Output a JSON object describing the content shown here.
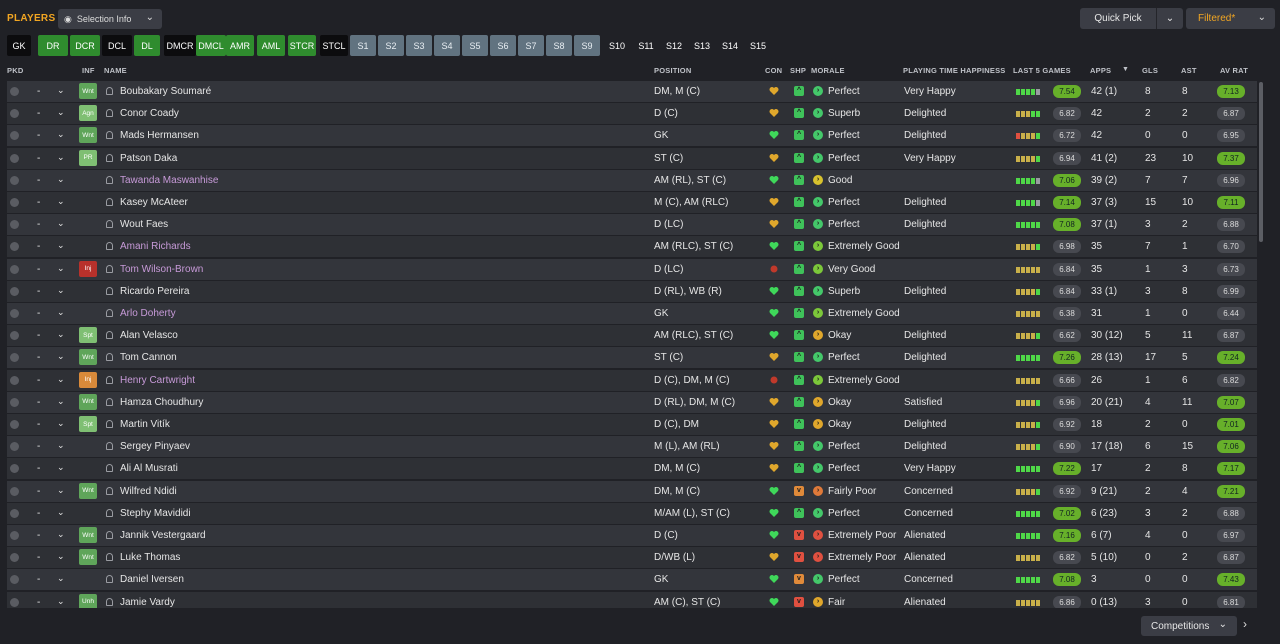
{
  "header": {
    "title": "PLAYERS",
    "selection_info": "Selection Info",
    "quick_pick": "Quick Pick",
    "filtered": "Filtered*",
    "competitions": "Competitions"
  },
  "icons": {
    "chevron": "chevron-down-icon",
    "eye": "eye-icon",
    "next": "chevron-right-icon"
  },
  "positions": [
    {
      "label": "GK",
      "style": "blk"
    },
    {
      "label": "DR",
      "style": "grn"
    },
    {
      "label": "DCR",
      "style": "grn"
    },
    {
      "label": "DCL",
      "style": "blk"
    },
    {
      "label": "DL",
      "style": "grn"
    },
    {
      "label": "DMCR",
      "style": "blk"
    },
    {
      "label": "DMCL",
      "style": "grn"
    },
    {
      "label": "AMR",
      "style": "grn"
    },
    {
      "label": "AML",
      "style": "grn"
    },
    {
      "label": "STCR",
      "style": "grn"
    },
    {
      "label": "STCL",
      "style": "blk"
    },
    {
      "label": "S1",
      "style": "sl"
    },
    {
      "label": "S2",
      "style": "sl"
    },
    {
      "label": "S3",
      "style": "sl"
    },
    {
      "label": "S4",
      "style": "sl"
    },
    {
      "label": "S5",
      "style": "sl"
    },
    {
      "label": "S6",
      "style": "sl"
    },
    {
      "label": "S7",
      "style": "sl"
    },
    {
      "label": "S8",
      "style": "sl"
    },
    {
      "label": "S9",
      "style": "sl"
    },
    {
      "label": "S10",
      "style": "nb"
    },
    {
      "label": "S11",
      "style": "nb"
    },
    {
      "label": "S12",
      "style": "nb"
    },
    {
      "label": "S13",
      "style": "nb"
    },
    {
      "label": "S14",
      "style": "nb"
    },
    {
      "label": "S15",
      "style": "nb"
    }
  ],
  "columns": {
    "pkd": "PKD",
    "inf": "INF",
    "name": "NAME",
    "position": "POSITION",
    "con": "CON",
    "shp": "SHP",
    "morale": "MORALE",
    "pth": "PLAYING TIME HAPPINESS",
    "l5": "LAST 5 GAMES",
    "apps": "APPS",
    "gls": "GLS",
    "ast": "AST",
    "avr": "AV RAT"
  },
  "colors": {
    "form_green": "#67b02a",
    "form_dark": "#474950",
    "pink_name": "#c79ad8",
    "accent": "#f2a622"
  },
  "players": [
    {
      "pkd": "-",
      "tag": "Wnt",
      "tagc": "#5fa55a",
      "name": "Boubakary Soumaré",
      "pink": false,
      "pos": "DM, M (C)",
      "con": "y",
      "shp": "g",
      "mor": "Perfect",
      "morc": "#44c86a",
      "pt": "Very Happy",
      "l5": "gggge",
      "form": "7.54",
      "formg": true,
      "apps": "42 (1)",
      "gls": "8",
      "ast": "8",
      "avr": "7.13",
      "avrg": true
    },
    {
      "pkd": "-",
      "tag": "Agn",
      "tagc": "#7fbf73",
      "name": "Conor Coady",
      "pink": false,
      "pos": "D (C)",
      "con": "y",
      "shp": "g",
      "mor": "Superb",
      "morc": "#44c86a",
      "pt": "Delighted",
      "l5": "yyygg",
      "form": "6.82",
      "formg": false,
      "apps": "42",
      "gls": "2",
      "ast": "2",
      "avr": "6.87",
      "avrg": false
    },
    {
      "pkd": "-",
      "tag": "Wnt",
      "tagc": "#5fa55a",
      "name": "Mads Hermansen",
      "pink": false,
      "pos": "GK",
      "con": "g",
      "shp": "g",
      "mor": "Perfect",
      "morc": "#44c86a",
      "pt": "Delighted",
      "l5": "ryyyg",
      "form": "6.72",
      "formg": false,
      "apps": "42",
      "gls": "0",
      "ast": "0",
      "avr": "6.95",
      "avrg": false
    },
    {
      "pkd": "-",
      "tag": "PR",
      "tagc": "#7fbf73",
      "name": "Patson Daka",
      "pink": false,
      "pos": "ST (C)",
      "con": "y",
      "shp": "g",
      "mor": "Perfect",
      "morc": "#44c86a",
      "pt": "Very Happy",
      "l5": "yyyyg",
      "form": "6.94",
      "formg": false,
      "apps": "41 (2)",
      "gls": "23",
      "ast": "10",
      "avr": "7.37",
      "avrg": true
    },
    {
      "pkd": "-",
      "tag": "",
      "tagc": "",
      "name": "Tawanda Maswanhise",
      "pink": true,
      "pos": "AM (RL), ST (C)",
      "con": "g",
      "shp": "g",
      "mor": "Good",
      "morc": "#d8c22e",
      "pt": "",
      "l5": "gggge",
      "form": "7.06",
      "formg": true,
      "apps": "39 (2)",
      "gls": "7",
      "ast": "7",
      "avr": "6.96",
      "avrg": false
    },
    {
      "pkd": "-",
      "tag": "",
      "tagc": "",
      "name": "Kasey McAteer",
      "pink": false,
      "pos": "M (C), AM (RLC)",
      "con": "y",
      "shp": "g",
      "mor": "Perfect",
      "morc": "#44c86a",
      "pt": "Delighted",
      "l5": "gggge",
      "form": "7.14",
      "formg": true,
      "apps": "37 (3)",
      "gls": "15",
      "ast": "10",
      "avr": "7.11",
      "avrg": true
    },
    {
      "pkd": "-",
      "tag": "",
      "tagc": "",
      "name": "Wout Faes",
      "pink": false,
      "pos": "D (LC)",
      "con": "y",
      "shp": "g",
      "mor": "Perfect",
      "morc": "#44c86a",
      "pt": "Delighted",
      "l5": "ggggg",
      "form": "7.08",
      "formg": true,
      "apps": "37 (1)",
      "gls": "3",
      "ast": "2",
      "avr": "6.88",
      "avrg": false
    },
    {
      "pkd": "-",
      "tag": "",
      "tagc": "",
      "name": "Amani Richards",
      "pink": true,
      "pos": "AM (RLC), ST (C)",
      "con": "g",
      "shp": "g",
      "mor": "Extremely Good",
      "morc": "#7cc83a",
      "pt": "",
      "l5": "yyyyg",
      "form": "6.98",
      "formg": false,
      "apps": "35",
      "gls": "7",
      "ast": "1",
      "avr": "6.70",
      "avrg": false
    },
    {
      "pkd": "-",
      "tag": "Inj",
      "tagc": "#b8312b",
      "name": "Tom Wilson-Brown",
      "pink": true,
      "pos": "D (LC)",
      "con": "r",
      "shp": "g",
      "mor": "Very Good",
      "morc": "#7cc83a",
      "pt": "",
      "l5": "yyyyy",
      "form": "6.84",
      "formg": false,
      "apps": "35",
      "gls": "1",
      "ast": "3",
      "avr": "6.73",
      "avrg": false
    },
    {
      "pkd": "-",
      "tag": "",
      "tagc": "",
      "name": "Ricardo Pereira",
      "pink": false,
      "pos": "D (RL), WB (R)",
      "con": "g",
      "shp": "g",
      "mor": "Superb",
      "morc": "#44c86a",
      "pt": "Delighted",
      "l5": "yyyyg",
      "form": "6.84",
      "formg": false,
      "apps": "33 (1)",
      "gls": "3",
      "ast": "8",
      "avr": "6.99",
      "avrg": false
    },
    {
      "pkd": "-",
      "tag": "",
      "tagc": "",
      "name": "Arlo Doherty",
      "pink": true,
      "pos": "GK",
      "con": "g",
      "shp": "g",
      "mor": "Extremely Good",
      "morc": "#7cc83a",
      "pt": "",
      "l5": "yyyyy",
      "form": "6.38",
      "formg": false,
      "apps": "31",
      "gls": "1",
      "ast": "0",
      "avr": "6.44",
      "avrg": false
    },
    {
      "pkd": "-",
      "tag": "Spt",
      "tagc": "#7fbf73",
      "name": "Alan Velasco",
      "pink": false,
      "pos": "AM (RLC), ST (C)",
      "con": "g",
      "shp": "g",
      "mor": "Okay",
      "morc": "#e0a72c",
      "pt": "Delighted",
      "l5": "yyyyg",
      "form": "6.62",
      "formg": false,
      "apps": "30 (12)",
      "gls": "5",
      "ast": "11",
      "avr": "6.87",
      "avrg": false
    },
    {
      "pkd": "-",
      "tag": "Wnt",
      "tagc": "#5fa55a",
      "name": "Tom Cannon",
      "pink": false,
      "pos": "ST (C)",
      "con": "y",
      "shp": "g",
      "mor": "Perfect",
      "morc": "#44c86a",
      "pt": "Delighted",
      "l5": "ggggg",
      "form": "7.26",
      "formg": true,
      "apps": "28 (13)",
      "gls": "17",
      "ast": "5",
      "avr": "7.24",
      "avrg": true
    },
    {
      "pkd": "-",
      "tag": "Inj",
      "tagc": "#d98a3a",
      "name": "Henry Cartwright",
      "pink": true,
      "pos": "D (C), DM, M (C)",
      "con": "r",
      "shp": "g",
      "mor": "Extremely Good",
      "morc": "#7cc83a",
      "pt": "",
      "l5": "yyyyy",
      "form": "6.66",
      "formg": false,
      "apps": "26",
      "gls": "1",
      "ast": "6",
      "avr": "6.82",
      "avrg": false
    },
    {
      "pkd": "-",
      "tag": "Wnt",
      "tagc": "#5fa55a",
      "name": "Hamza Choudhury",
      "pink": false,
      "pos": "D (RL), DM, M (C)",
      "con": "y",
      "shp": "g",
      "mor": "Okay",
      "morc": "#e0a72c",
      "pt": "Satisfied",
      "l5": "yyyyg",
      "form": "6.96",
      "formg": false,
      "apps": "20 (21)",
      "gls": "4",
      "ast": "11",
      "avr": "7.07",
      "avrg": true
    },
    {
      "pkd": "-",
      "tag": "Spt",
      "tagc": "#7fbf73",
      "name": "Martin Vitík",
      "pink": false,
      "pos": "D (C), DM",
      "con": "y",
      "shp": "g",
      "mor": "Okay",
      "morc": "#e0a72c",
      "pt": "Delighted",
      "l5": "yyyyg",
      "form": "6.92",
      "formg": false,
      "apps": "18",
      "gls": "2",
      "ast": "0",
      "avr": "7.01",
      "avrg": true
    },
    {
      "pkd": "-",
      "tag": "",
      "tagc": "",
      "name": "Sergey Pinyaev",
      "pink": false,
      "pos": "M (L), AM (RL)",
      "con": "y",
      "shp": "g",
      "mor": "Perfect",
      "morc": "#44c86a",
      "pt": "Delighted",
      "l5": "yyyyg",
      "form": "6.90",
      "formg": false,
      "apps": "17 (18)",
      "gls": "6",
      "ast": "15",
      "avr": "7.06",
      "avrg": true
    },
    {
      "pkd": "-",
      "tag": "",
      "tagc": "",
      "name": "Ali Al Musrati",
      "pink": false,
      "pos": "DM, M (C)",
      "con": "y",
      "shp": "g",
      "mor": "Perfect",
      "morc": "#44c86a",
      "pt": "Very Happy",
      "l5": "ggggg",
      "form": "7.22",
      "formg": true,
      "apps": "17",
      "gls": "2",
      "ast": "8",
      "avr": "7.17",
      "avrg": true
    },
    {
      "pkd": "-",
      "tag": "Wnt",
      "tagc": "#5fa55a",
      "name": "Wilfred Ndidi",
      "pink": false,
      "pos": "DM, M (C)",
      "con": "g",
      "shp": "o",
      "mor": "Fairly Poor",
      "morc": "#e07a3a",
      "pt": "Concerned",
      "l5": "yyyyg",
      "form": "6.92",
      "formg": false,
      "apps": "9 (21)",
      "gls": "2",
      "ast": "4",
      "avr": "7.21",
      "avrg": true
    },
    {
      "pkd": "-",
      "tag": "",
      "tagc": "",
      "name": "Stephy Mavididi",
      "pink": false,
      "pos": "M/AM (L), ST (C)",
      "con": "g",
      "shp": "g",
      "mor": "Perfect",
      "morc": "#44c86a",
      "pt": "Concerned",
      "l5": "ggggg",
      "form": "7.02",
      "formg": true,
      "apps": "6 (23)",
      "gls": "3",
      "ast": "2",
      "avr": "6.88",
      "avrg": false
    },
    {
      "pkd": "-",
      "tag": "Wnt",
      "tagc": "#5fa55a",
      "name": "Jannik Vestergaard",
      "pink": false,
      "pos": "D (C)",
      "con": "g",
      "shp": "r",
      "mor": "Extremely Poor",
      "morc": "#e05040",
      "pt": "Alienated",
      "l5": "ggggg",
      "form": "7.16",
      "formg": true,
      "apps": "6 (7)",
      "gls": "4",
      "ast": "0",
      "avr": "6.97",
      "avrg": false
    },
    {
      "pkd": "-",
      "tag": "Wnt",
      "tagc": "#5fa55a",
      "name": "Luke Thomas",
      "pink": false,
      "pos": "D/WB (L)",
      "con": "y",
      "shp": "r",
      "mor": "Extremely Poor",
      "morc": "#e05040",
      "pt": "Alienated",
      "l5": "yyyyy",
      "form": "6.82",
      "formg": false,
      "apps": "5 (10)",
      "gls": "0",
      "ast": "2",
      "avr": "6.87",
      "avrg": false
    },
    {
      "pkd": "-",
      "tag": "",
      "tagc": "",
      "name": "Daniel Iversen",
      "pink": false,
      "pos": "GK",
      "con": "g",
      "shp": "o",
      "mor": "Perfect",
      "morc": "#44c86a",
      "pt": "Concerned",
      "l5": "ggggg",
      "form": "7.08",
      "formg": true,
      "apps": "3",
      "gls": "0",
      "ast": "0",
      "avr": "7.43",
      "avrg": true
    },
    {
      "pkd": "-",
      "tag": "Unh",
      "tagc": "#5fa55a",
      "name": "Jamie Vardy",
      "pink": false,
      "pos": "AM (C), ST (C)",
      "con": "g",
      "shp": "r",
      "mor": "Fair",
      "morc": "#e0a72c",
      "pt": "Alienated",
      "l5": "yyyyy",
      "form": "6.86",
      "formg": false,
      "apps": "0 (13)",
      "gls": "3",
      "ast": "0",
      "avr": "6.81",
      "avrg": false
    }
  ]
}
